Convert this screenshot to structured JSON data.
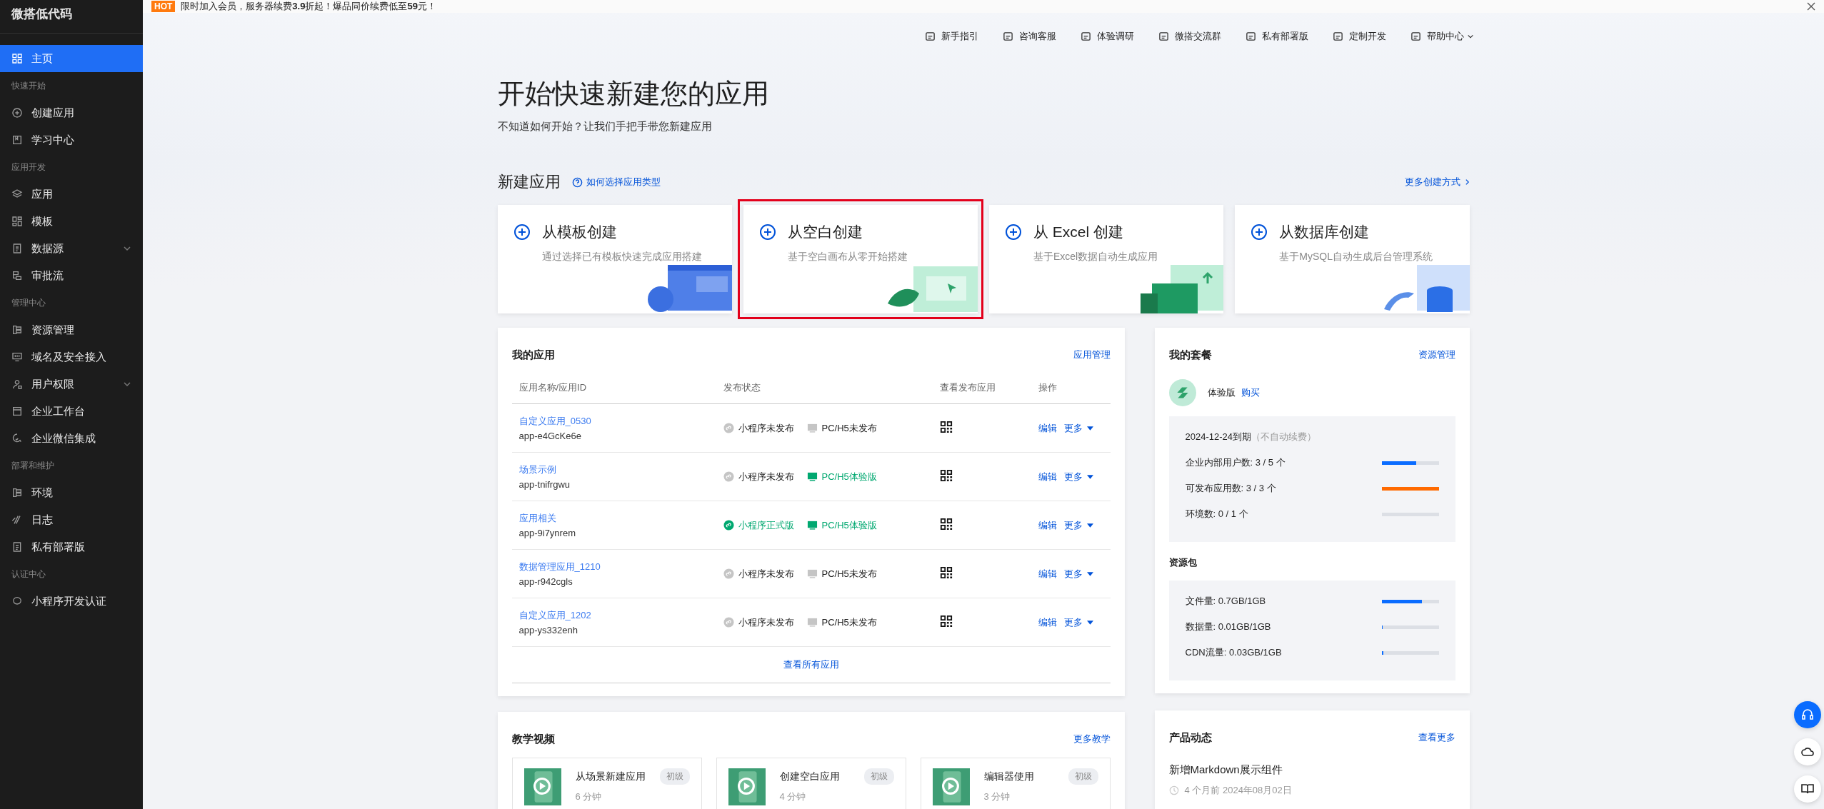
{
  "sidebar": {
    "logo": "微搭低代码",
    "sections": [
      {
        "items": [
          {
            "label": "主页",
            "selected": true,
            "expandable": false
          }
        ]
      },
      {
        "title": "快速开始",
        "items": [
          {
            "label": "创建应用",
            "selected": false,
            "expandable": false
          },
          {
            "label": "学习中心",
            "selected": false,
            "expandable": false
          }
        ]
      },
      {
        "title": "应用开发",
        "items": [
          {
            "label": "应用",
            "selected": false,
            "expandable": false
          },
          {
            "label": "模板",
            "selected": false,
            "expandable": false
          },
          {
            "label": "数据源",
            "selected": false,
            "expandable": true
          },
          {
            "label": "审批流",
            "selected": false,
            "expandable": false
          }
        ]
      },
      {
        "title": "管理中心",
        "items": [
          {
            "label": "资源管理",
            "selected": false,
            "expandable": false
          },
          {
            "label": "域名及安全接入",
            "selected": false,
            "expandable": false
          },
          {
            "label": "用户权限",
            "selected": false,
            "expandable": true
          },
          {
            "label": "企业工作台",
            "selected": false,
            "expandable": false
          },
          {
            "label": "企业微信集成",
            "selected": false,
            "expandable": false
          }
        ]
      },
      {
        "title": "部署和维护",
        "items": [
          {
            "label": "环境",
            "selected": false,
            "expandable": false
          },
          {
            "label": "日志",
            "selected": false,
            "expandable": false
          },
          {
            "label": "私有部署版",
            "selected": false,
            "expandable": false
          }
        ]
      },
      {
        "title": "认证中心",
        "items": [
          {
            "label": "小程序开发认证",
            "selected": false,
            "expandable": false
          }
        ]
      }
    ]
  },
  "banner": {
    "badge": "HOT",
    "text": "限时加入会员，服务器续费**3.9**折起！爆品同价续费低至**59**元！"
  },
  "toolbar": [
    {
      "label": "新手指引",
      "dropdown": false
    },
    {
      "label": "咨询客服",
      "dropdown": false
    },
    {
      "label": "体验调研",
      "dropdown": false
    },
    {
      "label": "微搭交流群",
      "dropdown": false
    },
    {
      "label": "私有部署版",
      "dropdown": false
    },
    {
      "label": "定制开发",
      "dropdown": false
    },
    {
      "label": "帮助中心",
      "dropdown": true
    }
  ],
  "hero": {
    "title": "开始快速新建您的应用",
    "subtitle": "不知道如何开始？让我们手把手带您新建应用"
  },
  "new_app": {
    "title": "新建应用",
    "help_link": "如何选择应用类型",
    "more_link": "更多创建方式",
    "cards": [
      {
        "title": "从模板创建",
        "description": "通过选择已有模板快速完成应用搭建",
        "highlighted": false
      },
      {
        "title": "从空白创建",
        "description": "基于空白画布从零开始搭建",
        "highlighted": true
      },
      {
        "title": "从 Excel 创建",
        "description": "基于Excel数据自动生成应用",
        "highlighted": false
      },
      {
        "title": "从数据库创建",
        "description": "基于MySQL自动生成后台管理系统",
        "highlighted": false
      }
    ]
  },
  "my_apps": {
    "title": "我的应用",
    "manage_link": "应用管理",
    "columns": [
      "应用名称/应用ID",
      "发布状态",
      "查看发布应用",
      "操作"
    ],
    "rows": [
      {
        "name": "自定义应用_0530",
        "id": "app-e4GcKe6e",
        "mini_program": {
          "label": "小程序未发布",
          "published": false
        },
        "web": {
          "label": "PC/H5未发布",
          "published": false
        },
        "edit": "编辑",
        "more": "更多"
      },
      {
        "name": "场景示例",
        "id": "app-tnifrgwu",
        "mini_program": {
          "label": "小程序未发布",
          "published": false
        },
        "web": {
          "label": "PC/H5体验版",
          "published": true
        },
        "edit": "编辑",
        "more": "更多"
      },
      {
        "name": "应用相关",
        "id": "app-9i7ynrem",
        "mini_program": {
          "label": "小程序正式版",
          "published": true
        },
        "web": {
          "label": "PC/H5体验版",
          "published": true
        },
        "edit": "编辑",
        "more": "更多"
      },
      {
        "name": "数据管理应用_1210",
        "id": "app-r942cgls",
        "mini_program": {
          "label": "小程序未发布",
          "published": false
        },
        "web": {
          "label": "PC/H5未发布",
          "published": false
        },
        "edit": "编辑",
        "more": "更多"
      },
      {
        "name": "自定义应用_1202",
        "id": "app-ys332enh",
        "mini_program": {
          "label": "小程序未发布",
          "published": false
        },
        "web": {
          "label": "PC/H5未发布",
          "published": false
        },
        "edit": "编辑",
        "more": "更多"
      }
    ],
    "view_all": "查看所有应用"
  },
  "tutorials": {
    "title": "教学视频",
    "more_link": "更多教学",
    "items": [
      {
        "title": "从场景新建应用",
        "duration": "6 分钟",
        "tag": "初级"
      },
      {
        "title": "创建空白应用",
        "duration": "4 分钟",
        "tag": "初级"
      },
      {
        "title": "编辑器使用",
        "duration": "3 分钟",
        "tag": "初级"
      }
    ]
  },
  "plan": {
    "title": "我的套餐",
    "manage_link": "资源管理",
    "edition": "体验版",
    "buy": "购买",
    "expiry": "2024-12-24到期",
    "expiry_note": "（不自动续费）",
    "quotas": [
      {
        "label": "企业内部用户数: 3 / 5 个",
        "level": 0.6
      },
      {
        "label": "可发布应用数: 3 / 3 个",
        "level": 1
      },
      {
        "label": "环境数: 0 / 1 个",
        "level": 0
      }
    ],
    "resource_title": "资源包",
    "resources": [
      {
        "label": "文件量: 0.7GB/1GB",
        "level": 0.7
      },
      {
        "label": "数据量: 0.01GB/1GB",
        "level": 0.01
      },
      {
        "label": "CDN流量: 0.03GB/1GB",
        "level": 0.03
      }
    ]
  },
  "news": {
    "title": "产品动态",
    "more_link": "查看更多",
    "items": [
      {
        "title": "新增Markdown展示组件",
        "time": "4 个月前 2024年08月02日"
      }
    ]
  }
}
